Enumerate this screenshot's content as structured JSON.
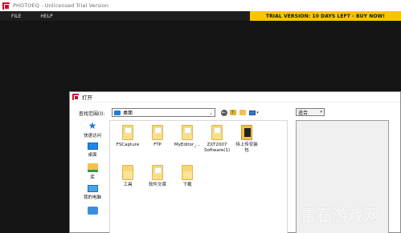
{
  "app": {
    "title": "PHOTOEQ  -  Unlicensed Trial Version",
    "menu": [
      "FILE",
      "HELP"
    ],
    "trial_banner": "TRIAL VERSION: 10 DAYS LEFT - BUY NOW!"
  },
  "dialog": {
    "title": "打开",
    "look_in_label": "查找范围(I):",
    "look_in_value": "桌面",
    "toolbar_icons": [
      "back-icon",
      "up-folder-icon",
      "new-folder-icon",
      "view-menu-icon"
    ],
    "places": [
      {
        "label": "快速访问",
        "icon": "star-icon"
      },
      {
        "label": "桌面",
        "icon": "desktop-icon"
      },
      {
        "label": "库",
        "icon": "library-icon"
      },
      {
        "label": "我的电脑",
        "icon": "computer-icon"
      },
      {
        "label": "",
        "icon": "network-icon"
      }
    ],
    "files": [
      {
        "label": "FSCapture",
        "icon": "folder-icon"
      },
      {
        "label": "FTP",
        "icon": "folder-icon"
      },
      {
        "label": "MyEditor_...",
        "icon": "folder-icon"
      },
      {
        "label": "ZXT2007\nSoftware(1)",
        "icon": "folder-icon"
      },
      {
        "label": "待上传安装\n包",
        "icon": "folder-icon"
      },
      {
        "label": "工具",
        "icon": "folder-icon"
      },
      {
        "label": "软件文章",
        "icon": "folder-icon"
      },
      {
        "label": "下载",
        "icon": "folder-icon"
      }
    ],
    "filter_value": "适合"
  },
  "watermark": "雷石游戏网",
  "colors": {
    "trial_banner": "#f7c600",
    "workspace": "#141414",
    "app_icon": "#c8102e"
  }
}
